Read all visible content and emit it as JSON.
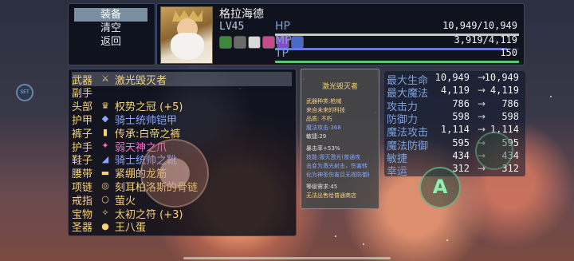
{
  "menu": {
    "items": [
      {
        "label": "装备",
        "active": true
      },
      {
        "label": "清空",
        "active": false
      },
      {
        "label": "返回",
        "active": false
      }
    ]
  },
  "character": {
    "name": "格拉海德",
    "level": "LV45",
    "buff_icons": [
      "buff-green-icon",
      "buff-mask-icon",
      "buff-white-icon",
      "buff-pink-icon",
      "buff-purple-icon",
      "buff-blue-icon"
    ],
    "bars": [
      {
        "label": "HP",
        "value": "10,949/10,949",
        "fraction": 1.0,
        "color": "#c8c8c8"
      },
      {
        "label": "MP",
        "value": "3,919/4,119",
        "fraction": 0.951,
        "color": "#6a7ad8"
      },
      {
        "label": "TP",
        "value": "150",
        "fraction": 1.0,
        "color": "#58c878"
      }
    ]
  },
  "equipment": [
    {
      "slot": "武器",
      "name": "激光毁灭者",
      "color": "#f6d37a",
      "icon": "sword-icon",
      "selected": true
    },
    {
      "slot": "副手",
      "name": "",
      "color": "#f6d37a",
      "icon": "",
      "selected": false
    },
    {
      "slot": "头部",
      "name": "权势之冠 (+5)",
      "color": "#f6d37a",
      "icon": "crown-icon",
      "selected": false
    },
    {
      "slot": "护甲",
      "name": "骑士统帅铠甲",
      "color": "#8aa6ff",
      "icon": "armor-icon",
      "selected": false
    },
    {
      "slot": "裤子",
      "name": "传承:白帝之裤",
      "color": "#f6d37a",
      "icon": "pants-icon",
      "selected": false
    },
    {
      "slot": "护手",
      "name": "弱天神之爪",
      "color": "#ff6ad0",
      "icon": "claw-icon",
      "selected": false
    },
    {
      "slot": "鞋子",
      "name": "骑士统帅之靴",
      "color": "#8aa6ff",
      "icon": "boots-icon",
      "selected": false
    },
    {
      "slot": "腰带",
      "name": "紧绷的龙筋",
      "color": "#f6d37a",
      "icon": "belt-icon",
      "selected": false
    },
    {
      "slot": "项链",
      "name": "刻耳柏洛斯的骨链",
      "color": "#f6d37a",
      "icon": "necklace-icon",
      "selected": false
    },
    {
      "slot": "戒指",
      "name": "萤火",
      "color": "#f6d37a",
      "icon": "ring-icon",
      "selected": false
    },
    {
      "slot": "宝物",
      "name": "太初之符 (+3)",
      "color": "#f6d37a",
      "icon": "charm-icon",
      "selected": false
    },
    {
      "slot": "圣器",
      "name": "王八蛋",
      "color": "#f6d37a",
      "icon": "egg-icon",
      "selected": false
    }
  ],
  "detail": {
    "title": "激光毁灭者",
    "lines": [
      {
        "text": "武器种类:枪械",
        "color": "#f6d37a"
      },
      {
        "text": "来自未来的科技",
        "color": "#f6d37a"
      },
      {
        "text": "品质: 不朽",
        "color": "#f6d37a"
      },
      {
        "text": "魔法攻击:368",
        "color": "#8aa6ff"
      },
      {
        "text": "敏捷:29",
        "color": "#e0e0e0"
      },
      {
        "text": "暴击率+53%",
        "color": "#e0e0e0"
      },
      {
        "text": "技能:毁灭激光(普通攻",
        "color": "#8aa6ff"
      },
      {
        "text": "击变为激光射击，伤害转",
        "color": "#8aa6ff"
      },
      {
        "text": "化为神圣伤害且无视防御)",
        "color": "#8aa6ff"
      },
      {
        "text": "等级需求:45",
        "color": "#e0e0e0"
      },
      {
        "text": "无法出售给普通商店",
        "color": "#f6d37a"
      }
    ]
  },
  "stats": [
    {
      "label": "最大生命",
      "old": "10,949",
      "new": "10,949"
    },
    {
      "label": "最大魔法",
      "old": "4,119",
      "new": "4,119"
    },
    {
      "label": "攻击力",
      "old": "786",
      "new": "786"
    },
    {
      "label": "防御力",
      "old": "598",
      "new": "598"
    },
    {
      "label": "魔法攻击",
      "old": "1,114",
      "new": "1,114"
    },
    {
      "label": "魔法防御",
      "old": "595",
      "new": "595"
    },
    {
      "label": "敏捷",
      "old": "434",
      "new": "434"
    },
    {
      "label": "幸运",
      "old": "312",
      "new": "312"
    }
  ],
  "controls": {
    "a_button": "A",
    "side_button": "SET"
  }
}
